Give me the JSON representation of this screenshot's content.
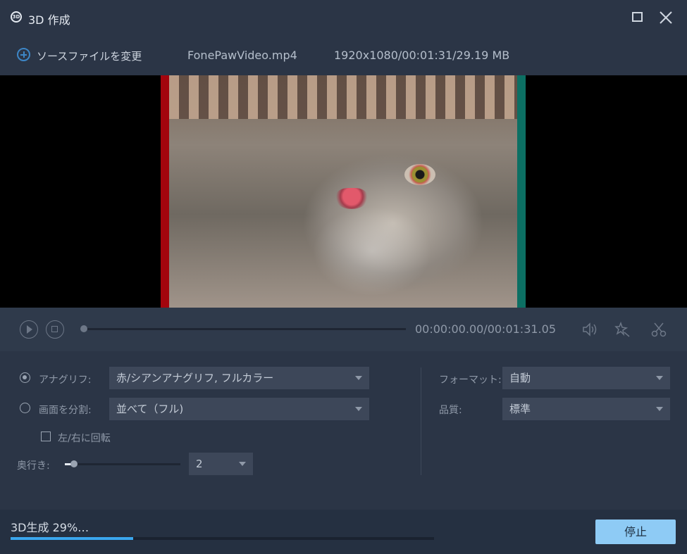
{
  "window": {
    "icon_text": "3D",
    "title": "3D 作成"
  },
  "source": {
    "change_label": "ソースファイルを変更",
    "filename": "FonePawVideo.mp4",
    "info": "1920x1080/00:01:31/29.19 MB"
  },
  "playback": {
    "timecode": "00:00:00.00/00:01:31.05",
    "position_fraction": 0.0
  },
  "settings": {
    "anaglyph_label": "アナグリフ:",
    "anaglyph_value": "赤/シアンアナグリフ, フルカラー",
    "anaglyph_selected": true,
    "split_label": "画面を分割:",
    "split_value": "並べて（フル)",
    "split_selected": false,
    "rotate_label": "左/右に回転",
    "rotate_checked": false,
    "depth_label": "奥行き:",
    "depth_value": "2",
    "depth_fraction": 0.08,
    "format_label": "フォーマット:",
    "format_value": "自動",
    "quality_label": "品質:",
    "quality_value": "標準"
  },
  "footer": {
    "progress_text": "3D生成 29%…",
    "progress_percent": 29,
    "stop_label": "停止"
  },
  "colors": {
    "accent": "#3aa6ee",
    "stop_button": "#8ecbf5",
    "background": "#2b3546"
  },
  "icons": [
    "app-3d-icon",
    "maximize-icon",
    "close-icon",
    "add-icon",
    "play-icon",
    "stop-icon",
    "volume-icon",
    "effects-icon",
    "cut-icon",
    "chevron-down-icon"
  ]
}
